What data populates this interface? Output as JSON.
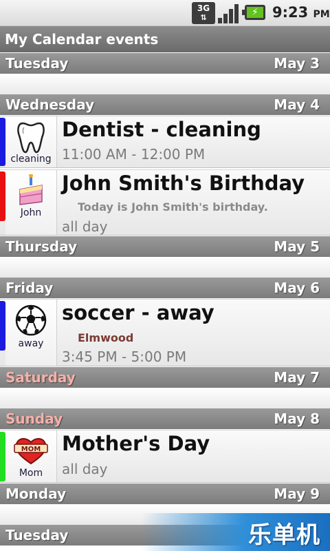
{
  "status_bar": {
    "network": "3G",
    "time": "9:23",
    "ampm": "PM",
    "icons": [
      "3g-data-icon",
      "signal-icon",
      "battery-charging-icon"
    ]
  },
  "title": "My Calendar events",
  "days": [
    {
      "day": "Tuesday",
      "date": "May 3"
    },
    {
      "day": "Wednesday",
      "date": "May 4"
    },
    {
      "day": "Thursday",
      "date": "May 5"
    },
    {
      "day": "Friday",
      "date": "May 6"
    },
    {
      "day": "Saturday",
      "date": "May 7"
    },
    {
      "day": "Sunday",
      "date": "May 8"
    },
    {
      "day": "Monday",
      "date": "May 9"
    },
    {
      "day": "Tuesday",
      "date": ""
    }
  ],
  "events": [
    {
      "title": "Dentist - cleaning",
      "icon_label": "cleaning",
      "icon": "tooth-icon",
      "time": "11:00 AM - 12:00 PM",
      "color": "#1a1ae0"
    },
    {
      "title": "John Smith's Birthday",
      "icon_label": "John",
      "icon": "birthday-cake-icon",
      "description": "Today is John Smith's birthday.",
      "time": "all day",
      "color": "#e81010"
    },
    {
      "title": "soccer - away",
      "icon_label": "away",
      "icon": "soccer-ball-icon",
      "location": "Elmwood",
      "time": "3:45 PM - 5:00 PM",
      "color": "#1a1ae0"
    },
    {
      "title": "Mother's Day",
      "icon_label": "Mom",
      "icon": "mom-heart-icon",
      "time": "all day",
      "color": "#22dd22"
    }
  ],
  "watermark": "乐单机",
  "colors": {
    "header_bg": "#8a8a8a",
    "weekend_text": "#f7b0a8"
  }
}
